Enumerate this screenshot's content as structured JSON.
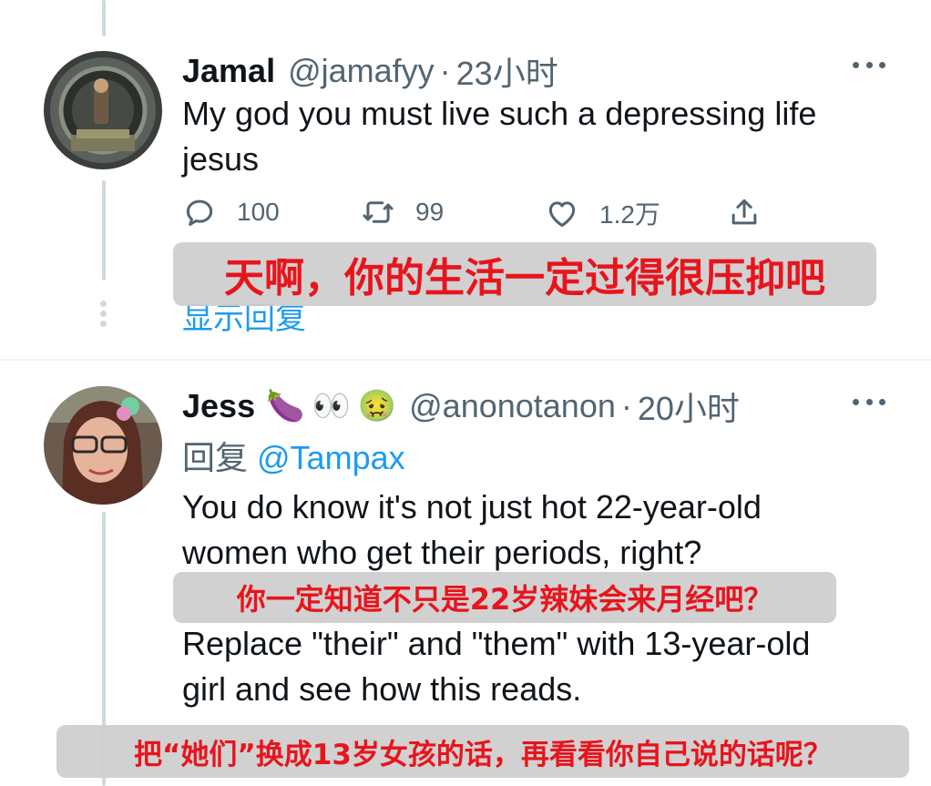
{
  "tweets": [
    {
      "name": "Jamal",
      "handle": "@jamafyy",
      "separator": "·",
      "time": "23小时",
      "text_lines": [
        "My god you must live such a depressing life",
        "jesus"
      ],
      "actions": {
        "reply_count": "100",
        "retweet_count": "99",
        "like_count": "1.2万"
      },
      "show_replies": "显示回复",
      "caption": "天啊，你的生活一定过得很压抑吧"
    },
    {
      "name": "Jess",
      "emojis": [
        "🍆",
        "👀",
        "🤢"
      ],
      "handle": "@anonotanon",
      "separator": "·",
      "time": "20小时",
      "reply_label": "回复",
      "reply_mention": "@Tampax",
      "text_lines_1": [
        "You do know it's not just hot 22-year-old",
        "women who get their periods, right?"
      ],
      "caption_1": "你一定知道不只是22岁辣妹会来月经吧？",
      "text_lines_2": [
        "Replace \"their\" and \"them\" with 13-year-old",
        "girl and see how this reads."
      ],
      "caption_2": "把“她们”换成13岁女孩的话，再看看你自己说的话呢？"
    }
  ],
  "icons": {
    "reply": "reply-icon",
    "retweet": "retweet-icon",
    "like": "heart-icon",
    "share": "share-icon",
    "more": "more-icon"
  },
  "colors": {
    "text": "#0f1419",
    "secondary": "#536471",
    "link": "#1d9bf0",
    "caption_text": "#e8141c",
    "thread_line": "#cfd9de"
  }
}
